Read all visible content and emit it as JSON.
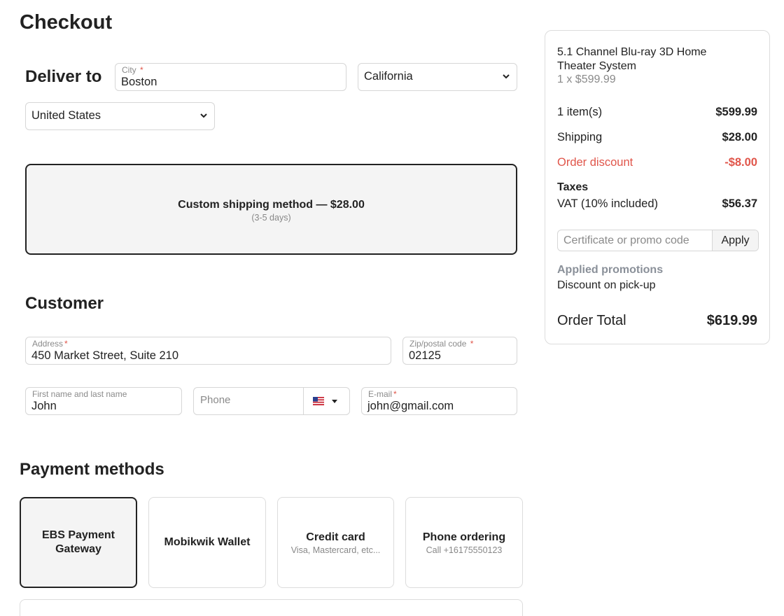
{
  "page": {
    "title": "Checkout"
  },
  "deliver": {
    "heading": "Deliver to",
    "city": {
      "label": "City",
      "required": "*",
      "value": "Boston"
    },
    "state": {
      "value": "California"
    },
    "country": {
      "value": "United States"
    }
  },
  "shipping": {
    "method_label": "Custom shipping method — $28.00",
    "eta": "(3-5 days)"
  },
  "customer": {
    "heading": "Customer",
    "address": {
      "label": "Address",
      "required": "*",
      "value": "450 Market Street, Suite 210"
    },
    "zip": {
      "label": "Zip/postal code",
      "required": "*",
      "value": "02125"
    },
    "name": {
      "label": "First name and last name",
      "value": "John"
    },
    "phone": {
      "placeholder": "Phone",
      "flag": "us-flag-icon"
    },
    "email": {
      "label": "E-mail",
      "required": "*",
      "value": "john@gmail.com"
    }
  },
  "payment": {
    "heading": "Payment methods",
    "methods": [
      {
        "name": "EBS Payment Gateway",
        "sub": "",
        "selected": true
      },
      {
        "name": "Mobikwik Wallet",
        "sub": "",
        "selected": false
      },
      {
        "name": "Credit card",
        "sub": "Visa, Mastercard, etc...",
        "selected": false
      },
      {
        "name": "Phone ordering",
        "sub": "Call +16175550123",
        "selected": false
      }
    ]
  },
  "summary": {
    "product_name": "5.1 Channel Blu-ray 3D Home Theater System",
    "product_qty_price": "1 x $599.99",
    "items_label": "1 item(s)",
    "items_value": "$599.99",
    "shipping_label": "Shipping",
    "shipping_value": "$28.00",
    "discount_label": "Order discount",
    "discount_value": "-$8.00",
    "taxes_heading": "Taxes",
    "vat_label": "VAT (10% included)",
    "vat_value": "$56.37",
    "promo_placeholder": "Certificate or promo code",
    "apply_label": "Apply",
    "promotions_heading": "Applied promotions",
    "promotion_item": "Discount on pick-up",
    "total_label": "Order Total",
    "total_value": "$619.99"
  },
  "colors": {
    "discount": "#e0554a",
    "selected_border": "#222222",
    "muted": "#8a8a8a"
  }
}
